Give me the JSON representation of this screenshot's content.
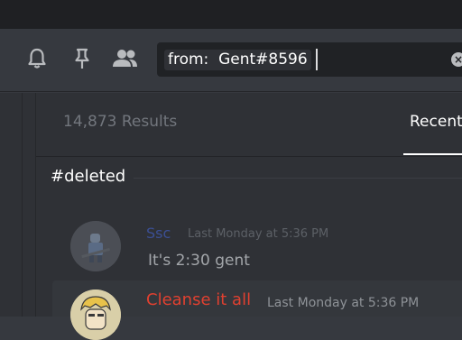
{
  "header": {
    "icons": {
      "bell": "bell-icon",
      "pin": "pin-icon",
      "members": "members-icon"
    },
    "search": {
      "query": "from:  Gent#8596",
      "clear_icon": "clear-icon"
    }
  },
  "results": {
    "count_label": "14,873 Results",
    "tabs": [
      {
        "label": "Recent",
        "active": true
      }
    ],
    "channel": "#deleted",
    "messages": [
      {
        "author": "Ssc",
        "timestamp": "Last Monday at 5:36 PM",
        "content": "It's 2:30 gent",
        "author_color": "#3b4f94"
      },
      {
        "author": "Cleanse it all",
        "timestamp": "Last Monday at 5:36 PM",
        "content": "",
        "author_color": "#e04030"
      }
    ]
  },
  "colors": {
    "background": "#36393f",
    "panel": "#2f3136",
    "search_bg": "#202225"
  }
}
